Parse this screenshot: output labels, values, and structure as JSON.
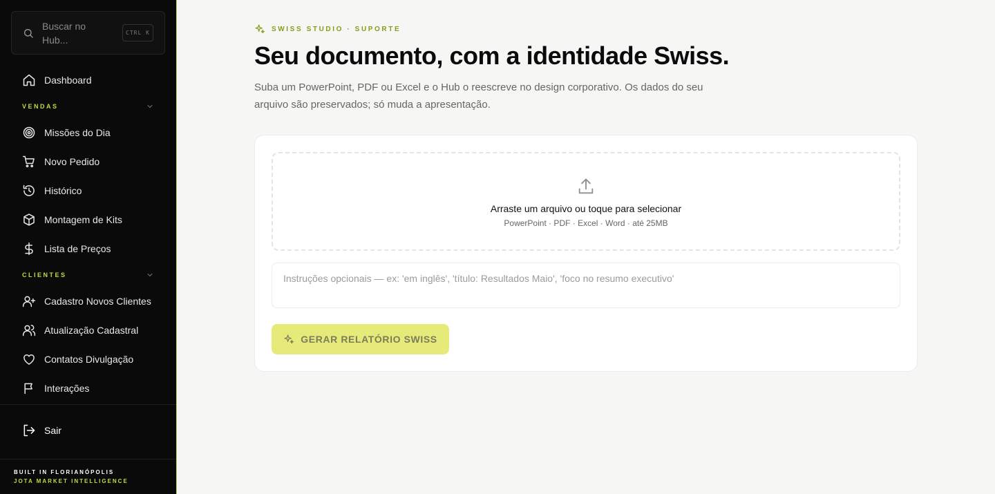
{
  "sidebar": {
    "search": {
      "placeholder": "Buscar no Hub...",
      "shortcut": "CTRL K"
    },
    "dashboard": {
      "label": "Dashboard",
      "icon": "home-icon"
    },
    "sections": [
      {
        "title": "VENDAS",
        "items": [
          {
            "label": "Missões do Dia",
            "icon": "target-icon"
          },
          {
            "label": "Novo Pedido",
            "icon": "cart-icon"
          },
          {
            "label": "Histórico",
            "icon": "history-icon"
          },
          {
            "label": "Montagem de Kits",
            "icon": "box-icon"
          },
          {
            "label": "Lista de Preços",
            "icon": "dollar-icon"
          }
        ]
      },
      {
        "title": "CLIENTES",
        "items": [
          {
            "label": "Cadastro Novos Clientes",
            "icon": "user-plus-icon"
          },
          {
            "label": "Atualização Cadastral",
            "icon": "users-icon"
          },
          {
            "label": "Contatos Divulgação",
            "icon": "heart-icon"
          },
          {
            "label": "Interações",
            "icon": "flag-icon"
          }
        ]
      }
    ],
    "logout": {
      "label": "Sair",
      "icon": "logout-icon"
    },
    "footer": {
      "line1": "BUILT IN FLORIANÓPOLIS",
      "line2": "JOTA MARKET INTELLIGENCE"
    }
  },
  "main": {
    "eyebrow": "SWISS STUDIO · SUPORTE",
    "title_prefix": "Seu documento, com a ",
    "title_bold": "identidade Swiss",
    "title_suffix": ".",
    "lead": "Suba um PowerPoint, PDF ou Excel e o Hub o reescreve no design corporativo. Os dados do seu arquivo são preservados; só muda a apresentação.",
    "upload": {
      "title": "Arraste um arquivo ou toque para selecionar",
      "formats": "PowerPoint · PDF · Excel · Word · até 25MB",
      "icon": "upload-icon"
    },
    "instructions_placeholder": "Instruções opcionais — ex: 'em inglês', 'título: Resultados Maio', 'foco no resumo executivo'",
    "generate_button": "GERAR RELATÓRIO SWISS"
  },
  "colors": {
    "sidebar_bg": "#0a0a0a",
    "accent": "#c7d93a",
    "eyebrow": "#8a9a1a",
    "button_bg": "#e5ea78",
    "page_bg": "#f6f6f4"
  }
}
